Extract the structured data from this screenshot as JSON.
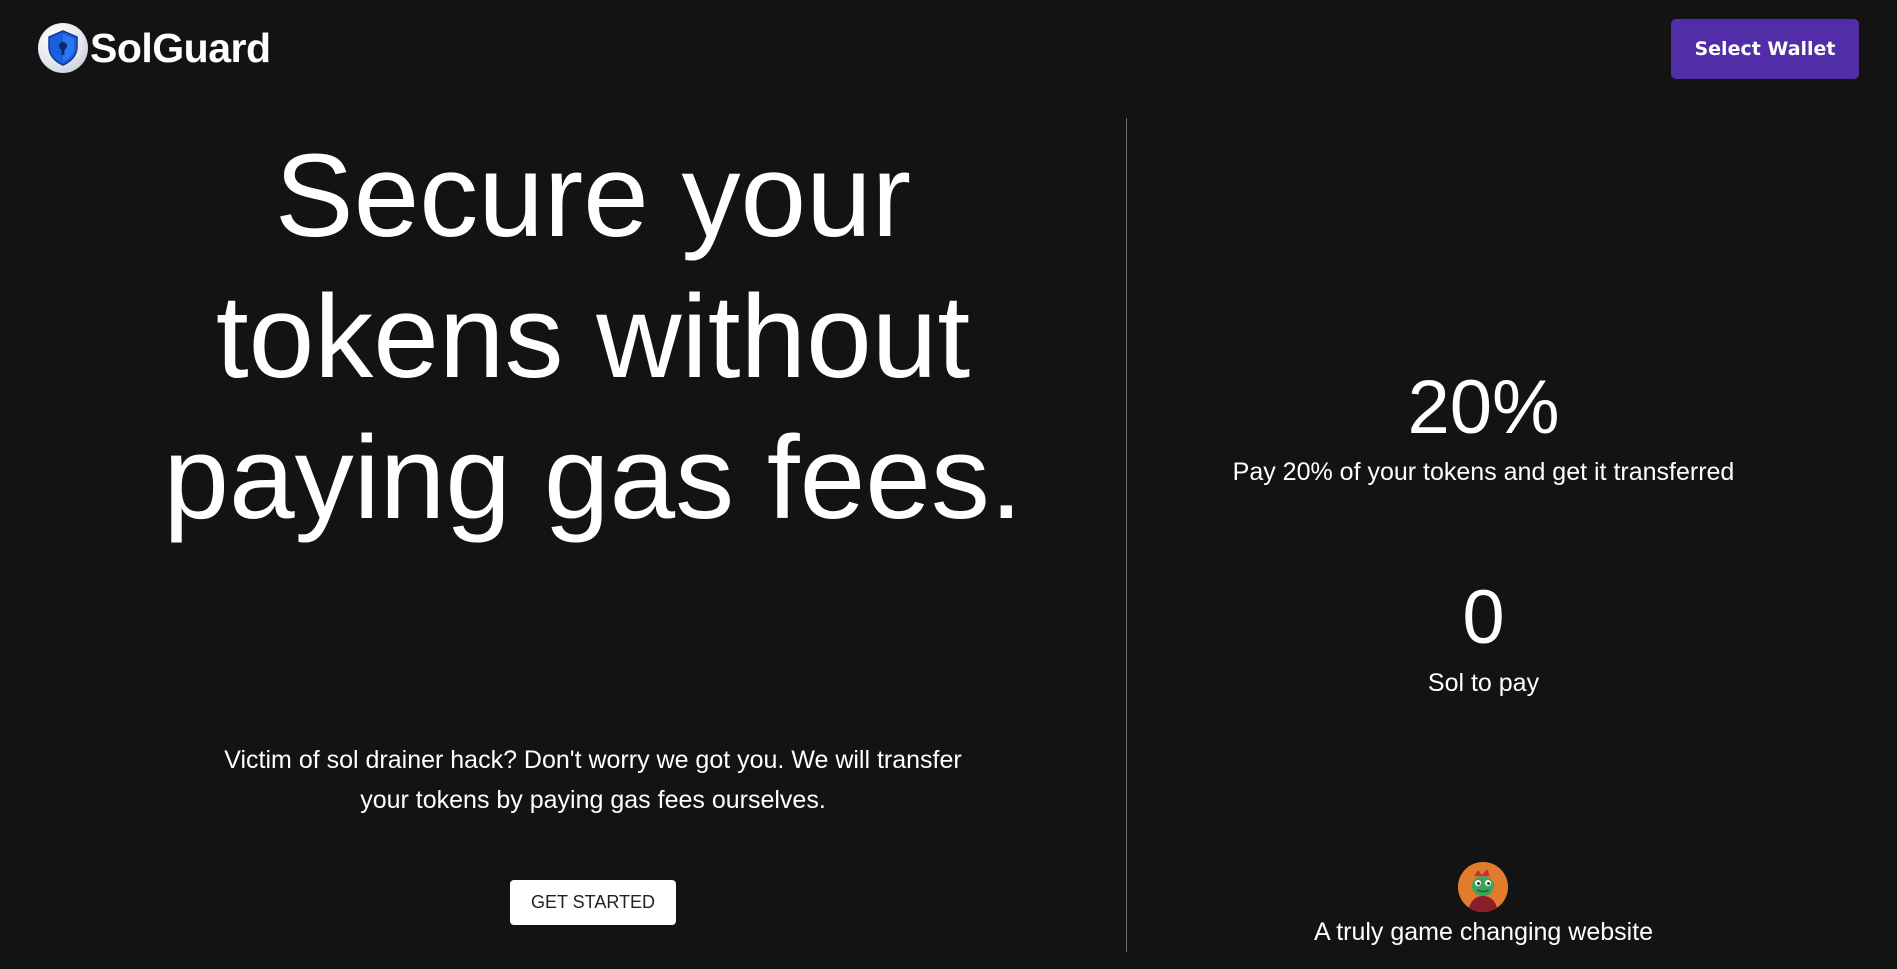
{
  "header": {
    "brand": "SolGuard",
    "logo_icon": "shield-icon",
    "wallet_button": "Select Wallet"
  },
  "hero": {
    "headline": "Secure your tokens without paying gas fees.",
    "subtext": "Victim of sol drainer hack? Don't worry we got you. We will transfer your tokens by paying gas fees ourselves.",
    "cta": "GET STARTED"
  },
  "stats": [
    {
      "value": "20%",
      "label": "Pay 20% of your tokens and get it transferred"
    },
    {
      "value": "0",
      "label": "Sol to pay"
    }
  ],
  "testimonial": {
    "avatar_icon": "avatar-icon",
    "text": "A truly game changing website"
  },
  "colors": {
    "background": "#131314",
    "accent": "#512da8",
    "text": "#ffffff"
  }
}
